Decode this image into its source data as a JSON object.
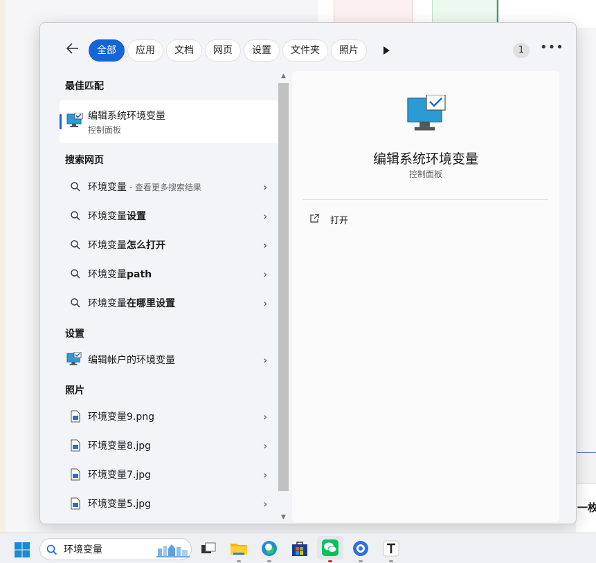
{
  "tabs": [
    {
      "label": "全部",
      "active": true
    },
    {
      "label": "应用"
    },
    {
      "label": "文档"
    },
    {
      "label": "网页"
    },
    {
      "label": "设置"
    },
    {
      "label": "文件夹"
    },
    {
      "label": "照片"
    }
  ],
  "badge_count": "1",
  "sections": {
    "best_match": "最佳匹配",
    "web": "搜索网页",
    "settings": "设置",
    "photos": "照片"
  },
  "best_match": {
    "name": "编辑系统环境变量",
    "sub": "控制面板"
  },
  "web_results": [
    {
      "query": "环境变量",
      "hint": " - 查看更多搜索结果"
    },
    {
      "prefix": "环境变量",
      "bold": "设置"
    },
    {
      "prefix": "环境变量",
      "bold": "怎么打开"
    },
    {
      "prefix": "环境变量",
      "bold": "path"
    },
    {
      "prefix": "环境变量",
      "bold": "在哪里设置"
    }
  ],
  "settings_results": [
    {
      "label": "编辑帐户的环境变量"
    }
  ],
  "photo_results": [
    {
      "label": "环境变量9.png"
    },
    {
      "label": "环境变量8.jpg"
    },
    {
      "label": "环境变量7.jpg"
    },
    {
      "label": "环境变量5.jpg"
    }
  ],
  "detail": {
    "title": "编辑系统环境变量",
    "sub": "控制面板",
    "open_label": "打开"
  },
  "taskbar": {
    "search_value": "环境变量"
  },
  "bg": {
    "side_text": "一枚"
  },
  "colors": {
    "accent": "#1665d8"
  }
}
